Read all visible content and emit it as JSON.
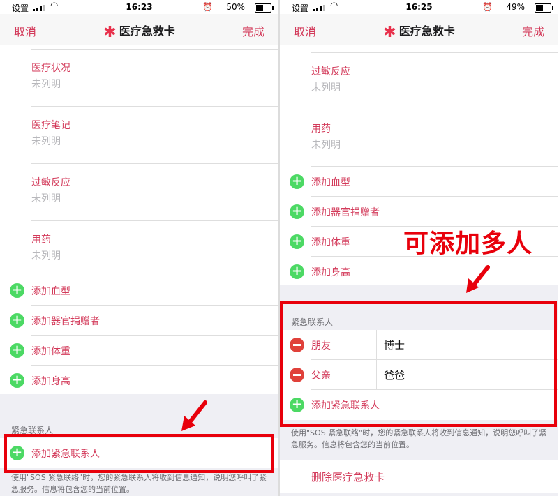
{
  "left": {
    "status": {
      "carrier": "设置",
      "time": "16:23",
      "battery": "50%"
    },
    "nav": {
      "cancel": "取消",
      "title": "医疗急救卡",
      "done": "完成"
    },
    "fields": [
      {
        "label": "医疗状况",
        "value": "未列明"
      },
      {
        "label": "医疗笔记",
        "value": "未列明"
      },
      {
        "label": "过敏反应",
        "value": "未列明"
      },
      {
        "label": "用药",
        "value": "未列明"
      }
    ],
    "adds": [
      "添加血型",
      "添加器官捐赠者",
      "添加体重",
      "添加身高"
    ],
    "section_title": "紧急联系人",
    "add_contact": "添加紧急联系人",
    "footnote": "使用\"SOS 紧急联络\"时，您的紧急联系人将收到信息通知，说明您呼叫了紧急服务。信息将包含您的当前位置。"
  },
  "right": {
    "status": {
      "carrier": "设置",
      "time": "16:25",
      "battery": "49%"
    },
    "nav": {
      "cancel": "取消",
      "title": "医疗急救卡",
      "done": "完成"
    },
    "fields": [
      {
        "label": "过敏反应",
        "value": "未列明"
      },
      {
        "label": "用药",
        "value": "未列明"
      }
    ],
    "adds": [
      "添加血型",
      "添加器官捐赠者",
      "添加体重",
      "添加身高"
    ],
    "section_title": "紧急联系人",
    "contacts": [
      {
        "relation": "朋友",
        "name": "博士"
      },
      {
        "relation": "父亲",
        "name": "爸爸"
      }
    ],
    "add_contact": "添加紧急联系人",
    "footnote": "使用\"SOS 紧急联络\"时，您的紧急联系人将收到信息通知，说明您呼叫了紧急服务。信息将包含您的当前位置。",
    "delete": "删除医疗急救卡"
  },
  "annotation": "可添加多人",
  "colors": {
    "accent": "#d33a5a",
    "add_green": "#4cd964",
    "remove_red": "#e0413a",
    "highlight": "#e8000b"
  }
}
